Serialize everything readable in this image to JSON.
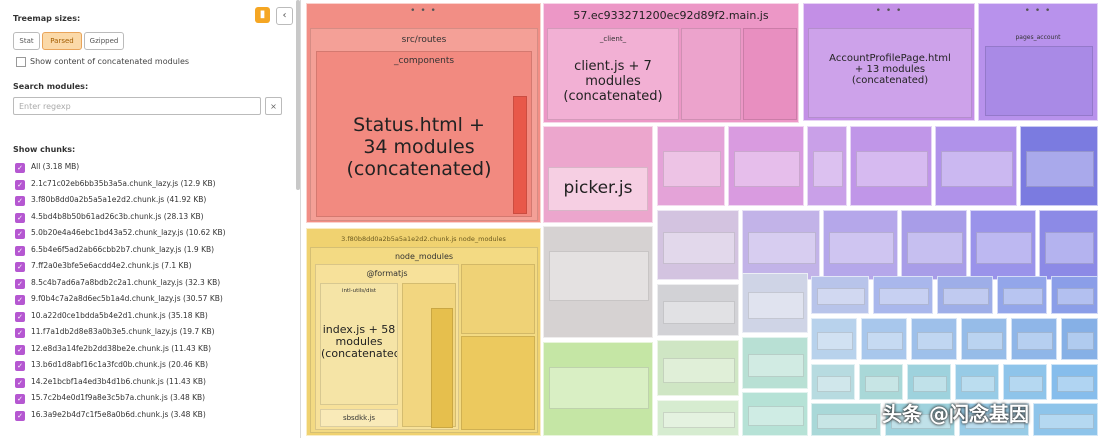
{
  "sidebar": {
    "show_chunks_label": "Treemap sizes:",
    "size_buttons": [
      "Stat",
      "Parsed",
      "Gzipped"
    ],
    "show_concat_label": "Show content of concatenated modules",
    "search_label": "Search modules:",
    "search_placeholder": "Enter regexp",
    "search_clear": "×",
    "chunks_label": "Show chunks:",
    "pin_icon": "pin-icon",
    "collapse_icon": "chevron-left-icon",
    "chunks": [
      "All (3.18 MB)",
      "2.1c71c02eb6bb35b3a5a.chunk_lazy.js  (12.9 KB)",
      "3.f80b8dd0a2b5a5a1e2d2.chunk.js  (41.92 KB)",
      "4.5bd4b8b50b61ad26c3b.chunk.js  (28.13 KB)",
      "5.0b20e4a46ebc1bd43a52.chunk_lazy.js  (10.62 KB)",
      "6.5b4e6f5ad2ab66cbb2b7.chunk_lazy.js  (1.9 KB)",
      "7.ff2a0e3bfe5e6acdd4e2.chunk.js  (7.1 KB)",
      "8.5c4b7ad6a7a8bdb2c2a1.chunk_lazy.js  (32.3 KB)",
      "9.f0b4c7a2a8d6ec5b1a4d.chunk_lazy.js  (30.57 KB)",
      "10.a22d0ce1bdda5b4e2d1.chunk.js  (35.18 KB)",
      "11.f7a1db2d8e83a0b3e5.chunk_lazy.js  (19.7 KB)",
      "12.e8d3a14fe2b2dd38be2e.chunk.js  (11.43 KB)",
      "13.b6d1d8abf16c1a3fcd0b.chunk.js  (20.46 KB)",
      "14.2e1bcbf1a4ed3b4d1b6.chunk.js  (11.43 KB)",
      "15.7c2b4e0d1f9a8e3c5b7a.chunk.js  (3.48 KB)",
      "16.3a9e2b4d7c1f5e8a0b6d.chunk.js  (3.48 KB)"
    ]
  },
  "treemap": {
    "dots": "• • •",
    "red": {
      "module_label": "src/routes",
      "components_label": "_components",
      "big_label": "Status.html +\n34 modules\n(concatenated)"
    },
    "yellow": {
      "header": "3.f80b8dd0a2b5a5a1e2d2.chunk.js  node_modules",
      "node_modules_label": "node_modules",
      "formatjs_label": "@formatjs",
      "inner_label": "intl-utils/dist",
      "big_label": "index.js + 58\nmodules\n(concatenated)",
      "small_label": "sbsdkk.js"
    },
    "pink": {
      "file_label": "57.ec933271200ec92d89f2.main.js",
      "client_label": "_client_",
      "big_label": "client.js + 7\nmodules\n(concatenated)",
      "picker_label": "picker.js"
    },
    "purple": {
      "big_label": "AccountProfilePage.html\n+ 13 modules\n(concatenated)",
      "top_right_label": "pages_account"
    }
  },
  "watermark": "头条 @闪念基因",
  "colors": {
    "red": "#f28e85",
    "yellow": "#f0d270",
    "pink": "#ec97c6",
    "purple": "#c38fe6",
    "blue": "#8f8fe6",
    "green": "#c5e6a5",
    "teal": "#a9d8d8",
    "checkbox": "#b557d1"
  }
}
